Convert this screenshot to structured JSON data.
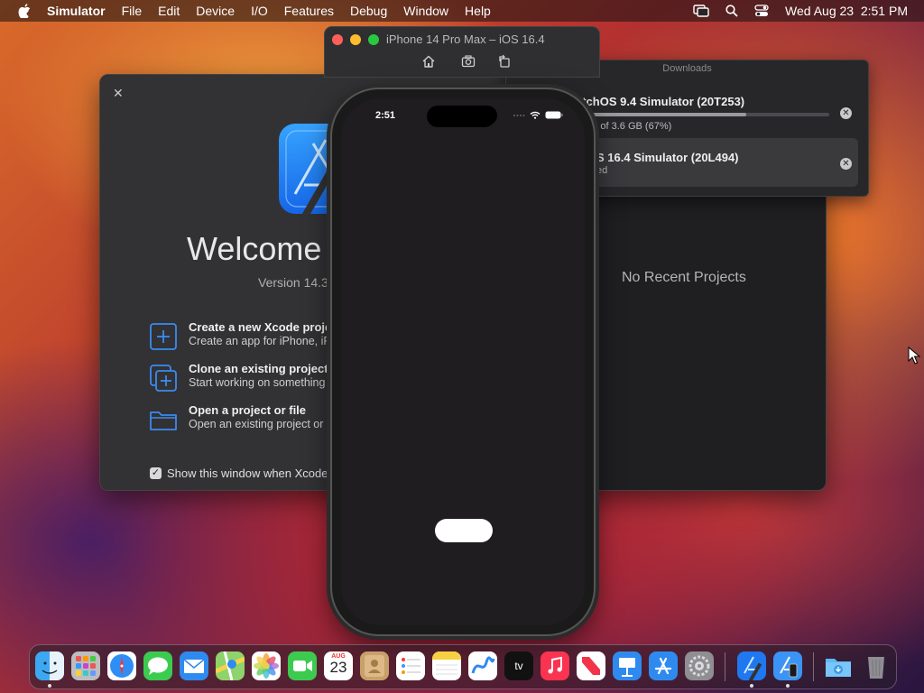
{
  "menubar": {
    "app_name": "Simulator",
    "items": [
      "File",
      "Edit",
      "Device",
      "I/O",
      "Features",
      "Debug",
      "Window",
      "Help"
    ],
    "clock": "Wed Aug 23  2:51 PM"
  },
  "simulator": {
    "window_title": "iPhone 14 Pro Max – iOS 16.4",
    "status_time": "2:51"
  },
  "downloads": {
    "header": "Downloads",
    "item1_name": "atchOS 9.4 Simulator (20T253)",
    "item1_status": "B of 3.6 GB (67%)",
    "item1_progress": 0.67,
    "item2_name": "S 16.4 Simulator (20L494)",
    "item2_status": "ed"
  },
  "welcome": {
    "title": "Welcome",
    "version": "Version 14.3.1",
    "actions": [
      {
        "title": "Create a new Xcode proje",
        "subtitle": "Create an app for iPhone, iP"
      },
      {
        "title": "Clone an existing project",
        "subtitle": "Start working on something"
      },
      {
        "title": "Open a project or file",
        "subtitle": "Open an existing project or f"
      }
    ],
    "show_window": "Show this window when Xcode",
    "no_recent": "No Recent Projects"
  },
  "dock": {
    "calendar_month": "AUG",
    "calendar_day": "23",
    "tv_label": "tv"
  }
}
